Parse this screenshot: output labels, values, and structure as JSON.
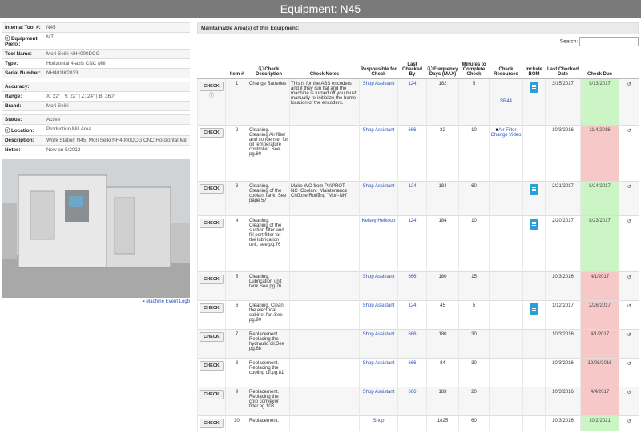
{
  "page_title": "Equipment: N45",
  "info": [
    {
      "key": "Internal Tool #:",
      "value": "N45"
    },
    {
      "key": "ⓘ Equipment Prefix:",
      "value": "MT"
    },
    {
      "key": "Tool Name:",
      "value": "Mori Seiki NH4000DCG"
    },
    {
      "key": "Type:",
      "value": "Horizontal 4-axis CNC Mill"
    },
    {
      "key": "Serial Number:",
      "value": "NH401IK2833"
    },
    {
      "key": "",
      "value": ""
    },
    {
      "key": "Accuracy:",
      "value": ""
    },
    {
      "key": "Range:",
      "value": "X: 22\" | Y: 22\" | Z: 24\" | B: 360°"
    },
    {
      "key": "Brand:",
      "value": "Mori Seiki"
    },
    {
      "key": "",
      "value": ""
    },
    {
      "key": "Status:",
      "value": "Active"
    },
    {
      "key": "ⓘ Location:",
      "value": "Production Mill Area"
    },
    {
      "key": "Description:",
      "value": "Work Station N45, Mori Seiki NH4000DCG CNC Horizontal Mill"
    },
    {
      "key": "Notes:",
      "value": "New on 5/2012"
    }
  ],
  "logbook_link": "Machine Event Logb",
  "section_title": "Maintainable Area(s) of this Equipment:",
  "search_label": "Search:",
  "search_value": "",
  "columns": [
    "",
    "Item #",
    "ⓘ Check Description",
    "Check Notes",
    "Responsible for Check",
    "Last Checked By",
    "ⓘ Frequency Days (MAX)",
    "Minutes to Complete Check",
    "Check Resources",
    "Include BOM",
    "Last Checked Date",
    "Check Due",
    ""
  ],
  "check_label": "CHECK",
  "rows": [
    {
      "item": "1",
      "desc": "Change Batteries",
      "notes": "This is for the ABS encoders and if they run flat and the machine is turned off you must manually re-initialize the home location of the encoders.",
      "resp": "Shop Assistant",
      "by": "124",
      "freq": "182",
      "min": "5",
      "res": "SR44",
      "bom": true,
      "date": "3/15/2017",
      "due": "9/13/2017",
      "status": "ok"
    },
    {
      "item": "2",
      "desc": "Cleaning. Cleaning Air filter and condenser for oil temperature controller. See pg.80",
      "notes": "",
      "resp": "Shop Assistant",
      "by": "666",
      "freq": "32",
      "min": "10",
      "res": "Air Filter Change Video",
      "bom": false,
      "date": "10/3/2016",
      "due": "11/4/2016",
      "status": "overdue"
    },
    {
      "item": "3",
      "desc": "Cleaning. Cleaning of the coolant tank. See page 57",
      "notes": "Make WO from P:\\\\PROT-NC_Coolant_Maintenance Choose Routing \"Mori-NH\"",
      "resp": "Shop Assistant",
      "by": "124",
      "freq": "184",
      "min": "60",
      "res": "",
      "bom": true,
      "date": "2/21/2017",
      "due": "8/24/2017",
      "status": "ok"
    },
    {
      "item": "4",
      "desc": "Cleaning. Cleaning of the suction filter and fill port filter for the lubrication unit. see pg.76",
      "notes": "",
      "resp": "Kelsey Heikoop",
      "by": "124",
      "freq": "184",
      "min": "10",
      "res": "",
      "bom": true,
      "date": "2/20/2017",
      "due": "8/23/2017",
      "status": "ok"
    },
    {
      "item": "5",
      "desc": "Cleaning. Lubrication unit tank See pg.76",
      "notes": "",
      "resp": "Shop Assistant",
      "by": "666",
      "freq": "180",
      "min": "15",
      "res": "",
      "bom": false,
      "date": "10/3/2016",
      "due": "4/1/2017",
      "status": "overdue"
    },
    {
      "item": "6",
      "desc": "Cleaning. Clean the electrical cabinet fan.See pg.90",
      "notes": "",
      "resp": "Shop Assistant",
      "by": "124",
      "freq": "45",
      "min": "5",
      "res": "",
      "bom": true,
      "date": "1/12/2017",
      "due": "2/26/2017",
      "status": "overdue"
    },
    {
      "item": "7",
      "desc": "Replacement. Replacing the hydraulic oil.See pg.68",
      "notes": "",
      "resp": "Shop Assistant",
      "by": "666",
      "freq": "180",
      "min": "30",
      "res": "",
      "bom": false,
      "date": "10/3/2016",
      "due": "4/1/2017",
      "status": "overdue"
    },
    {
      "item": "8",
      "desc": "Replacement. Replacing the cooling oil.pg.81",
      "notes": "",
      "resp": "Shop Assistant",
      "by": "666",
      "freq": "84",
      "min": "30",
      "res": "",
      "bom": false,
      "date": "10/3/2016",
      "due": "12/26/2016",
      "status": "overdue"
    },
    {
      "item": "9",
      "desc": "Replacement. Replacing the chip conveyor filter.pg.108",
      "notes": "",
      "resp": "Shop Assistant",
      "by": "666",
      "freq": "183",
      "min": "20",
      "res": "",
      "bom": false,
      "date": "10/3/2016",
      "due": "4/4/2017",
      "status": "overdue"
    },
    {
      "item": "10",
      "desc": "Replacement.",
      "notes": "",
      "resp": "Shop",
      "by": "",
      "freq": "1825",
      "min": "60",
      "res": "",
      "bom": false,
      "date": "10/3/2016",
      "due": "10/2/2021",
      "status": "ok"
    }
  ],
  "colors": {
    "ok": "#ccf5c5",
    "overdue": "#f7c8c8",
    "link": "#2a52be",
    "title_bar": "#7a7a7a"
  }
}
